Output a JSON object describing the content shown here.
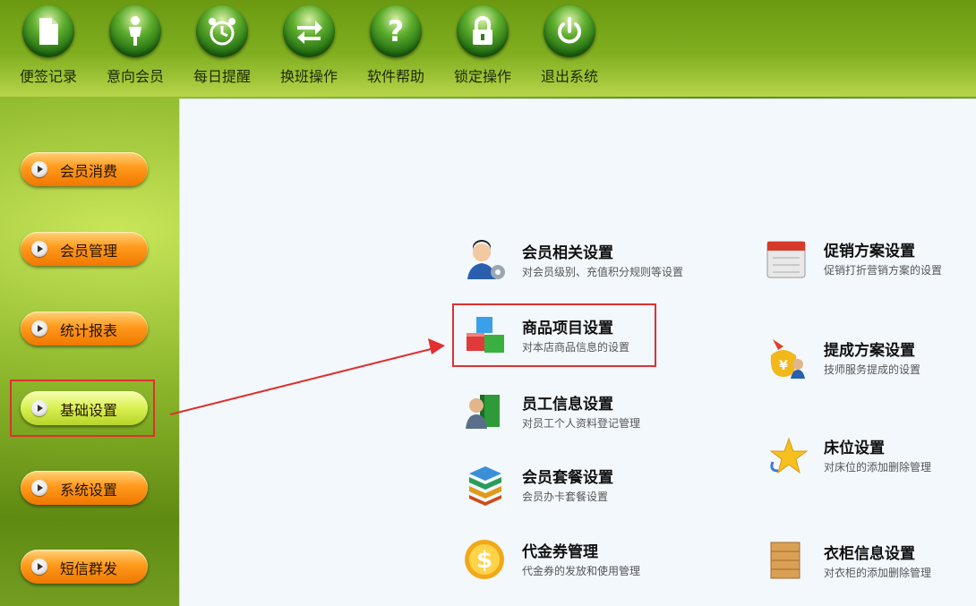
{
  "toolbar": {
    "items": [
      {
        "label": "便签记录",
        "icon": "note-icon"
      },
      {
        "label": "意向会员",
        "icon": "person-icon"
      },
      {
        "label": "每日提醒",
        "icon": "alarm-clock-icon"
      },
      {
        "label": "换班操作",
        "icon": "swap-arrows-icon"
      },
      {
        "label": "软件帮助",
        "icon": "question-icon"
      },
      {
        "label": "锁定操作",
        "icon": "lock-icon"
      },
      {
        "label": "退出系统",
        "icon": "power-icon"
      }
    ]
  },
  "nav": {
    "items": [
      {
        "label": "会员消费"
      },
      {
        "label": "会员管理"
      },
      {
        "label": "统计报表"
      },
      {
        "label": "基础设置",
        "active": true
      },
      {
        "label": "系统设置"
      },
      {
        "label": "短信群发"
      }
    ]
  },
  "settings": {
    "left": [
      {
        "title": "会员相关设置",
        "desc": "对会员级别、充值积分规则等设置",
        "icon": "member-gear-icon"
      },
      {
        "title": "商品项目设置",
        "desc": "对本店商品信息的设置",
        "icon": "cubes-icon"
      },
      {
        "title": "员工信息设置",
        "desc": "对员工个人资料登记管理",
        "icon": "employee-book-icon"
      },
      {
        "title": "会员套餐设置",
        "desc": "会员办卡套餐设置",
        "icon": "layers-icon"
      },
      {
        "title": "代金券管理",
        "desc": "代金券的发放和使用管理",
        "icon": "dollar-coin-icon"
      }
    ],
    "right": [
      {
        "title": "促销方案设置",
        "desc": "促销打折营销方案的设置",
        "icon": "calendar-icon"
      },
      {
        "title": "提成方案设置",
        "desc": "技师服务提成的设置",
        "icon": "money-bag-icon"
      },
      {
        "title": "床位设置",
        "desc": "对床位的添加删除管理",
        "icon": "star-icon"
      },
      {
        "title": "衣柜信息设置",
        "desc": "对衣柜的添加删除管理",
        "icon": "wardrobe-icon"
      }
    ]
  },
  "colors": {
    "accent_red": "#e03030",
    "nav_orange": "#ff9a1c",
    "nav_active": "#d8f050",
    "panel_bg": "#f3f8fd"
  }
}
